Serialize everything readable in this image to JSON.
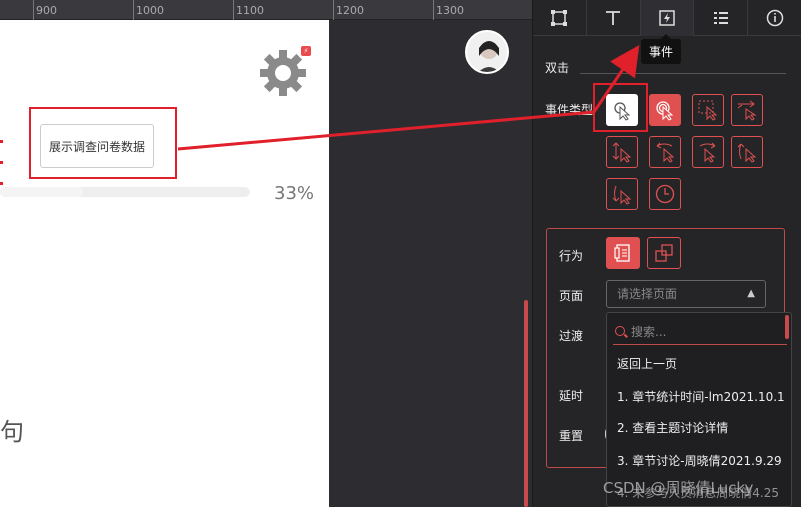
{
  "ruler": {
    "ticks": [
      "900",
      "1000",
      "1100",
      "1200",
      "1300"
    ]
  },
  "canvas": {
    "survey_button_label": "展示调查问卷数据",
    "progress_value": 0.33,
    "progress_text": "33%",
    "partial_char": "句"
  },
  "panel": {
    "tabs": [
      {
        "icon": "frame-icon"
      },
      {
        "icon": "text-icon"
      },
      {
        "icon": "bolt-icon"
      },
      {
        "icon": "list-icon"
      },
      {
        "icon": "info-icon"
      }
    ],
    "tooltip": "事件",
    "trigger_label": "双击",
    "event_type_label": "事件类型",
    "action_label": "行为",
    "page_label": "页面",
    "transition_label": "过渡",
    "delay_label": "延时",
    "reset_label": "重置",
    "page_select_placeholder": "请选择页面",
    "search_placeholder": "搜索...",
    "dropdown_items": [
      "返回上一页",
      "1. 章节统计时间-lm2021.10.1",
      "2. 查看主题讨论详情",
      "3. 章节讨论-周晓倩2021.9.29",
      "4. 未参与人员消息周晓倩4.25"
    ]
  },
  "watermark": "CSDN @周晓倩Lucky",
  "colors": {
    "accent": "#e05050",
    "highlight": "#e0202a"
  }
}
